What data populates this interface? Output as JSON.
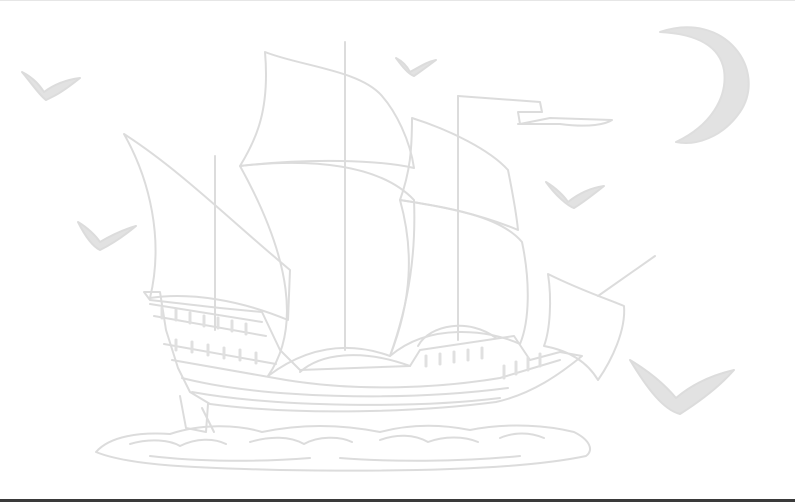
{
  "image": {
    "subject": "ship-with-birds-and-moon",
    "colors": {
      "background": "#ffffff",
      "line": "#dcdcdc",
      "fill": "#e2e2e2",
      "border": "#3a3a3a"
    },
    "icons": [
      "crescent-moon-icon",
      "bird-icon",
      "sailing-ship-icon",
      "waves-icon"
    ]
  }
}
